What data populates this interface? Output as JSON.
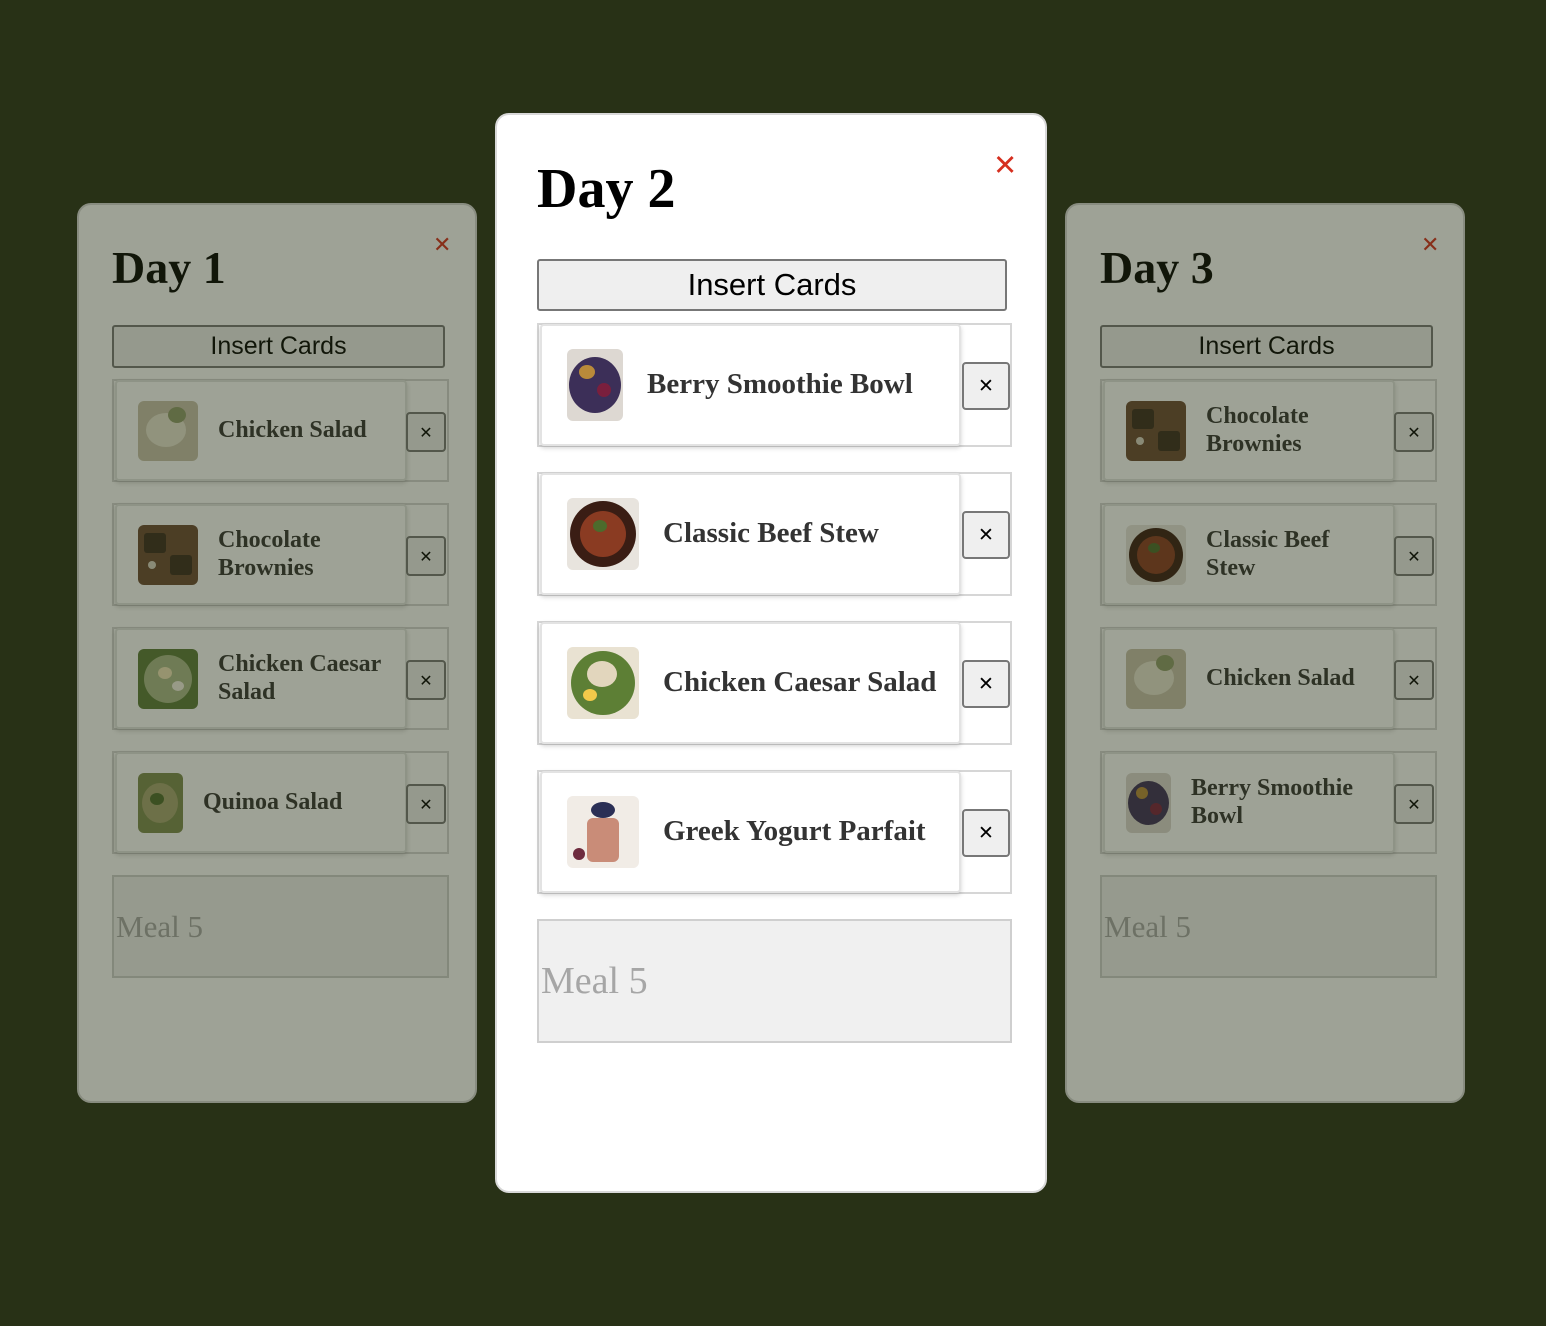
{
  "days": [
    {
      "title": "Day 1",
      "close": "✕",
      "insert_label": "Insert Cards",
      "remove_label": "✕",
      "meals": [
        "Chicken Salad",
        "Chocolate Brownies",
        "Chicken Caesar Salad",
        "Quinoa Salad"
      ],
      "empty_label": "Meal 5"
    },
    {
      "title": "Day 2",
      "close": "✕",
      "insert_label": "Insert Cards",
      "remove_label": "✕",
      "meals": [
        "Berry Smoothie Bowl",
        "Classic Beef Stew",
        "Chicken Caesar Salad",
        "Greek Yogurt Parfait"
      ],
      "empty_label": "Meal 5"
    },
    {
      "title": "Day 3",
      "close": "✕",
      "insert_label": "Insert Cards",
      "remove_label": "✕",
      "meals": [
        "Chocolate Brownies",
        "Classic Beef Stew",
        "Chicken Salad",
        "Berry Smoothie Bowl"
      ],
      "empty_label": "Meal 5"
    }
  ],
  "colors": {
    "background": "#283116",
    "close": "#d62f1f"
  }
}
